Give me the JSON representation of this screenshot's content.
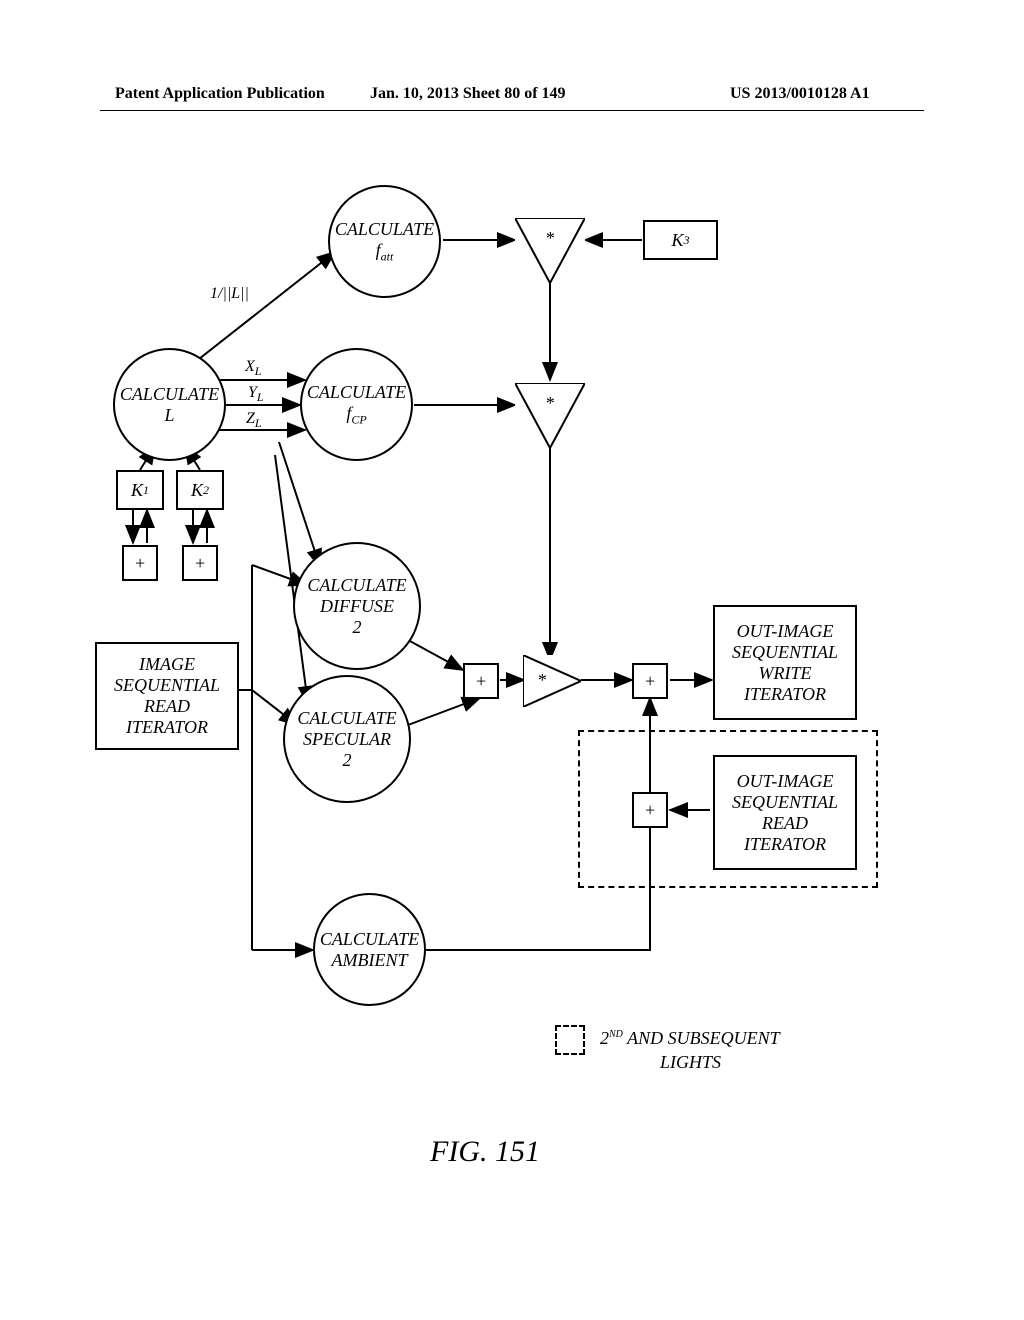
{
  "header": {
    "left": "Patent Application Publication",
    "center": "Jan. 10, 2013  Sheet 80 of 149",
    "right": "US 2013/0010128 A1"
  },
  "nodes": {
    "calc_l_line1": "CALCULATE",
    "calc_l_line2": "L",
    "calc_fatt_line1": "CALCULATE",
    "calc_fatt_line2": "f",
    "calc_fatt_sub": "att",
    "calc_fcp_line1": "CALCULATE",
    "calc_fcp_line2": "f",
    "calc_fcp_sub": "CP",
    "calc_diffuse_line1": "CALCULATE",
    "calc_diffuse_line2": "DIFFUSE",
    "calc_diffuse_line3": "2",
    "calc_specular_line1": "CALCULATE",
    "calc_specular_line2": "SPECULAR",
    "calc_specular_line3": "2",
    "calc_ambient_line1": "CALCULATE",
    "calc_ambient_line2": "AMBIENT",
    "k1": "K",
    "k1_sub": "1",
    "k2": "K",
    "k2_sub": "2",
    "k3": "K",
    "k3_sub": "3",
    "image_read_line1": "IMAGE",
    "image_read_line2": "SEQUENTIAL",
    "image_read_line3": "READ",
    "image_read_line4": "ITERATOR",
    "out_write_line1": "OUT-IMAGE",
    "out_write_line2": "SEQUENTIAL",
    "out_write_line3": "WRITE",
    "out_write_line4": "ITERATOR",
    "out_read_line1": "OUT-IMAGE",
    "out_read_line2": "SEQUENTIAL",
    "out_read_line3": "READ",
    "out_read_line4": "ITERATOR"
  },
  "ops": {
    "mult": "*",
    "plus": "+"
  },
  "labels": {
    "one_over_l": "1/||L||",
    "xl": "X",
    "xl_sub": "L",
    "yl": "Y",
    "yl_sub": "L",
    "zl": "Z",
    "zl_sub": "L"
  },
  "legend": {
    "text_line1": "2",
    "text_sup": "ND",
    "text_line1b": " AND SUBSEQUENT",
    "text_line2": "LIGHTS"
  },
  "caption": "FIG. 151"
}
